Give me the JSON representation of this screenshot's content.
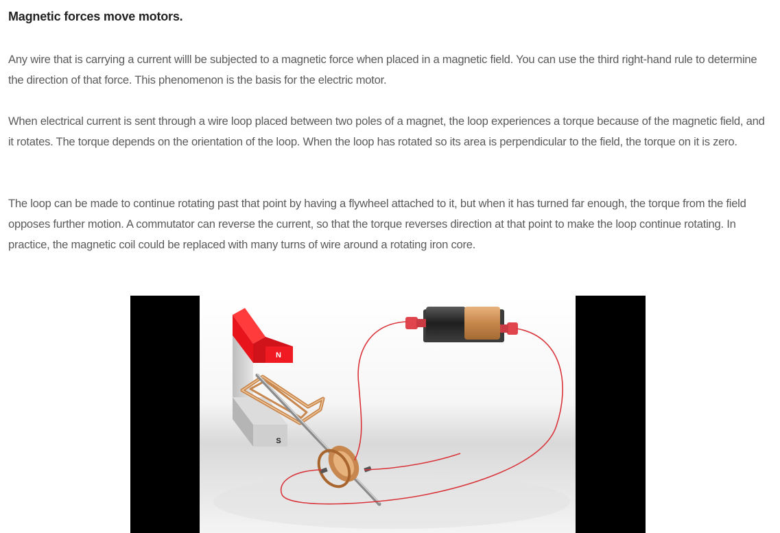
{
  "article": {
    "heading": "Magnetic forces move motors.",
    "paragraphs": [
      "Any wire that is carrying a current willl be subjected to a magnetic force when placed in a magnetic field. You can use the third right-hand rule to determine the direction of that force. This phenomenon is the basis for the electric motor.",
      "When electrical current is sent through a wire loop placed between two poles of a magnet, the loop experiences a torque because of the magnetic field, and it rotates. The torque depends on the orientation of the loop. When the loop has rotated so its area is perpendicular to the field, the torque on it is zero.",
      "The loop can be made to continue rotating past that point by having a flywheel attached to it, but when it has turned far enough, the torque from the field opposes further motion. A commutator can reverse the current, so that the torque reverses direction at that point to make the loop continue rotating. In practice, the magnetic coil could be replaced with many turns of wire around a rotating iron core."
    ]
  },
  "figure": {
    "north_label": "N",
    "south_label": "S",
    "colors": {
      "magnet_north": "#e8141c",
      "magnet_south": "#d4d4d4",
      "wire": "#d9343a",
      "coil": "#c8874e",
      "battery_body": "#2a2a2a",
      "battery_band": "#c98a4a",
      "letterbox": "#000000"
    }
  }
}
